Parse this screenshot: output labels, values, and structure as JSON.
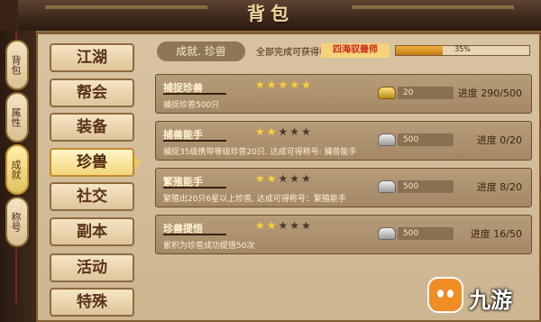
{
  "window": {
    "title": "背包"
  },
  "side_tabs": [
    {
      "label": "背包",
      "active": false
    },
    {
      "label": "属性",
      "active": false
    },
    {
      "label": "成就",
      "active": true
    },
    {
      "label": "称号",
      "active": false
    }
  ],
  "categories": [
    {
      "label": "江湖",
      "active": false
    },
    {
      "label": "帮会",
      "active": false
    },
    {
      "label": "装备",
      "active": false
    },
    {
      "label": "珍兽",
      "active": true
    },
    {
      "label": "社交",
      "active": false
    },
    {
      "label": "副本",
      "active": false
    },
    {
      "label": "活动",
      "active": false
    },
    {
      "label": "特殊",
      "active": false
    }
  ],
  "header": {
    "breadcrumb": "成就. 珍兽",
    "reward_label": "全部完成可获得称号：",
    "reward_title": "四海驭兽师",
    "progress_label": "35%",
    "progress_fraction": 0.35
  },
  "achievements": [
    {
      "name": "捕捉珍兽",
      "stars": 5,
      "max_stars": 5,
      "desc": "捕捉珍兽500只",
      "reward_icon": "gold-ingot-icon",
      "reward_amount": "20",
      "progress": "进度 290/500"
    },
    {
      "name": "捕兽能手",
      "stars": 2,
      "max_stars": 5,
      "desc": "捕捉35级携带等级珍兽20只. 达成可得称号: 捕兽能手",
      "reward_icon": "silver-ingot-icon",
      "reward_amount": "500",
      "progress": "进度 0/20"
    },
    {
      "name": "繁殖能手",
      "stars": 2,
      "max_stars": 5,
      "desc": "繁殖出20只6星以上珍兽, 达成可得称号：繁殖能手",
      "reward_icon": "silver-ingot-icon",
      "reward_amount": "500",
      "progress": "进度 8/20"
    },
    {
      "name": "珍兽提悟",
      "stars": 2,
      "max_stars": 5,
      "desc": "累积为珍兽成功提悟50次",
      "reward_icon": "silver-ingot-icon",
      "reward_amount": "500",
      "progress": "进度 16/50"
    }
  ],
  "watermark": {
    "text": "九游",
    "icon": "jiuyou-logo-icon"
  }
}
